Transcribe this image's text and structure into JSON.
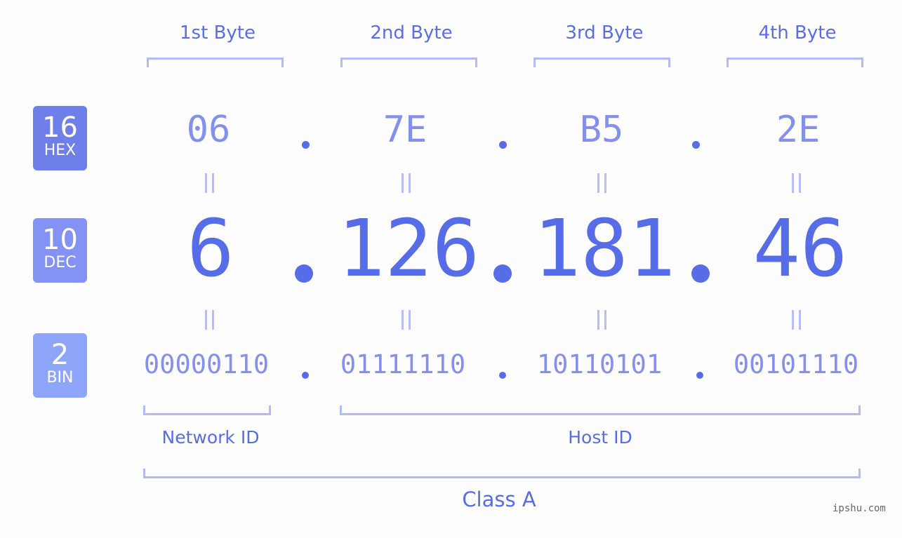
{
  "byte_headers": [
    "1st Byte",
    "2nd Byte",
    "3rd Byte",
    "4th Byte"
  ],
  "bases": {
    "hex": {
      "num": "16",
      "label": "HEX"
    },
    "dec": {
      "num": "10",
      "label": "DEC"
    },
    "bin": {
      "num": "2",
      "label": "BIN"
    }
  },
  "hex": [
    "06",
    "7E",
    "B5",
    "2E"
  ],
  "dec": [
    "6",
    "126",
    "181",
    "46"
  ],
  "bin": [
    "00000110",
    "01111110",
    "10110101",
    "00101110"
  ],
  "segments": {
    "network": "Network ID",
    "host": "Host ID",
    "class": "Class A"
  },
  "watermark": "ipshu.com",
  "colors": {
    "accent": "#576de8",
    "bracket": "#b3bbf5",
    "hex_badge": "#6e7fe9",
    "dec_badge": "#8392f3",
    "bin_badge": "#8ea6f9"
  }
}
